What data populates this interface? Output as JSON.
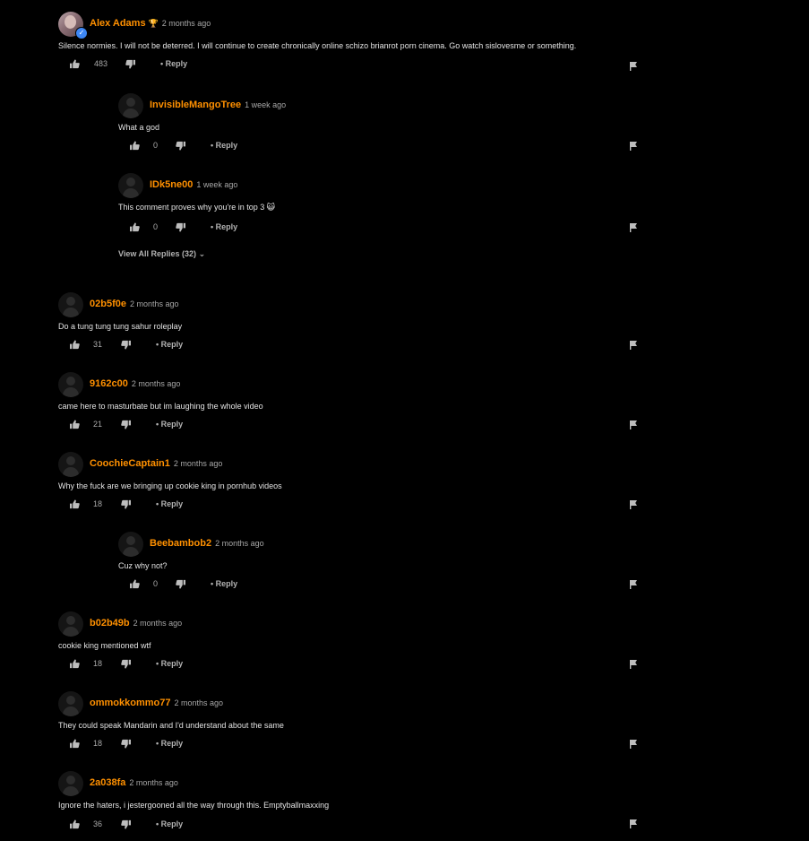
{
  "comments": [
    {
      "user": "Alex Adams",
      "time": "2 months ago",
      "text": "Silence normies. I will not be deterred. I will continue to create chronically online schizo brianrot porn cinema. Go watch sislovesme or something.",
      "likes": "483",
      "reply_label": "• Reply",
      "verified": true,
      "trophy": true
    },
    {
      "user": "InvisibleMangoTree",
      "time": "1 week ago",
      "text": "What a god",
      "likes": "0",
      "reply_label": "• Reply"
    },
    {
      "user": "IDk5ne00",
      "time": "1 week ago",
      "text": "This comment proves why you're in top 3 😺",
      "likes": "0",
      "reply_label": "• Reply"
    },
    {
      "user": "02b5f0e",
      "time": "2 months ago",
      "text": "Do a tung tung tung sahur roleplay",
      "likes": "31",
      "reply_label": "• Reply"
    },
    {
      "user": "9162c00",
      "time": "2 months ago",
      "text": "came here to masturbate but im laughing the whole video",
      "likes": "21",
      "reply_label": "• Reply"
    },
    {
      "user": "CoochieCaptain1",
      "time": "2 months ago",
      "text": "Why the fuck are we bringing up cookie king in pornhub videos",
      "likes": "18",
      "reply_label": "• Reply"
    },
    {
      "user": "Beebambob2",
      "time": "2 months ago",
      "text": "Cuz why not?",
      "likes": "0",
      "reply_label": "• Reply"
    },
    {
      "user": "b02b49b",
      "time": "2 months ago",
      "text": "cookie king mentioned wtf",
      "likes": "18",
      "reply_label": "• Reply"
    },
    {
      "user": "ommokkommo77",
      "time": "2 months ago",
      "text": "They could speak Mandarin and I'd understand about the same",
      "likes": "18",
      "reply_label": "• Reply"
    },
    {
      "user": "2a038fa",
      "time": "2 months ago",
      "text": "Ignore the haters, i jestergooned all the way through this. Emptyballmaxxing",
      "likes": "36",
      "reply_label": "• Reply"
    }
  ],
  "view_all_replies": "View All Replies (32)",
  "icons": {
    "thumbs_up": "thumbs-up-icon",
    "thumbs_down": "thumbs-down-icon",
    "flag": "flag-icon",
    "verified": "verified-check-icon",
    "trophy": "trophy-icon"
  },
  "colors": {
    "username": "#ff9000",
    "background": "#000000",
    "verified": "#3d87f5"
  }
}
